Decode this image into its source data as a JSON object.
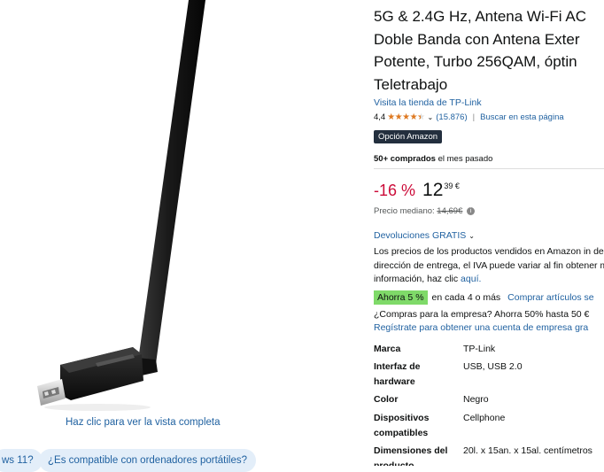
{
  "gallery": {
    "view_full_label": "Haz clic para ver la vista completa",
    "chips": [
      "ws 11?",
      "¿Es compatible con ordenadores portátiles?"
    ]
  },
  "product": {
    "title_lines": [
      "5G & 2.4G Hz, Antena Wi-Fi AC",
      "Doble Banda con Antena Exter",
      "Potente, Turbo 256QAM, óptin",
      "Teletrabajo"
    ],
    "store_link": "Visita la tienda de TP-Link",
    "rating": "4,4",
    "rating_stars": 4.4,
    "rating_count": "(15.876)",
    "search_page": "Buscar en esta página",
    "badge": "Opción Amazon",
    "bought_bold": "50+ comprados",
    "bought_rest": "el mes pasado",
    "discount": "-16 %",
    "price_int": "12",
    "price_frac": "39 €",
    "median_label": "Precio mediano:",
    "median_price": "14,69€",
    "returns_label": "Devoluciones GRATIS",
    "returns_text": "Los precios de los productos vendidos en Amazon in de tu dirección de entrega, el IVA puede variar al fin obtener más información, haz clic",
    "returns_link": "aquí.",
    "save_badge": "Ahorra 5 %",
    "save_text": "en cada 4 o más",
    "buy_link": "Comprar artículos se",
    "business_text": "¿Compras para la empresa? Ahorra 50% hasta 50 €",
    "register_link": "Regístrate para obtener una cuenta de empresa gra"
  },
  "specs": [
    {
      "label": "Marca",
      "value": "TP-Link"
    },
    {
      "label": "Interfaz de hardware",
      "value": "USB, USB 2.0"
    },
    {
      "label": "Color",
      "value": "Negro"
    },
    {
      "label": "Dispositivos compatibles",
      "value": "Cellphone"
    },
    {
      "label": "Dimensiones del producto",
      "value": "20l. x 15an. x 15al. centímetros"
    }
  ],
  "colors": {
    "link": "#2162a1",
    "deal": "#cc0c39",
    "badge_bg": "#232f3e",
    "save_bg": "#7fda69",
    "star": "#de7921"
  }
}
